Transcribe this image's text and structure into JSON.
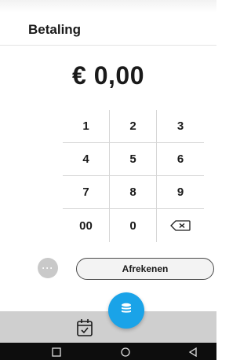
{
  "header": {
    "title": "Betaling"
  },
  "amount": {
    "display": "€ 0,00"
  },
  "keypad": {
    "keys": [
      "1",
      "2",
      "3",
      "4",
      "5",
      "6",
      "7",
      "8",
      "9",
      "00",
      "0"
    ],
    "backspace_icon": "backspace-icon"
  },
  "actions": {
    "more_label": "···",
    "checkout_label": "Afrekenen"
  },
  "bottom_bar": {
    "left_icon": "calendar-check-icon",
    "fab_icon": "coins-stack-icon",
    "fab_color": "#1aa3e8"
  },
  "system_nav": {
    "icons": [
      "recents-square-icon",
      "home-circle-icon",
      "back-triangle-icon"
    ]
  }
}
